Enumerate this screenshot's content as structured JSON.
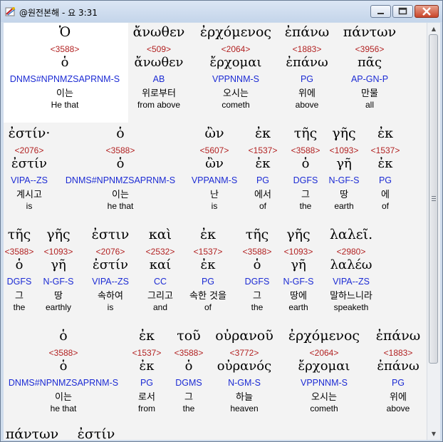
{
  "window": {
    "title": "@원전본해 - 요 3:31"
  },
  "rows": [
    [
      {
        "greek": "Ὁ",
        "strong": "<3588>",
        "lemma": "ὁ",
        "morph": "DNMS#NPNMZSAPRNM-S",
        "korean": "이는",
        "english": "He that"
      },
      {
        "greek": "ἄνωθεν",
        "strong": "<509>",
        "lemma": "ἄνωθεν",
        "morph": "AB",
        "korean": "위로부터",
        "english": "from above"
      },
      {
        "greek": "ἐρχόμενος",
        "strong": "<2064>",
        "lemma": "ἔρχομαι",
        "morph": "VPPNNM-S",
        "korean": "오시는",
        "english": "cometh"
      },
      {
        "greek": "ἐπάνω",
        "strong": "<1883>",
        "lemma": "ἐπάνω",
        "morph": "PG",
        "korean": "위에",
        "english": "above"
      },
      {
        "greek": "πάντων",
        "strong": "<3956>",
        "lemma": "πᾶς",
        "morph": "AP-GN-P",
        "korean": "만물",
        "english": "all"
      }
    ],
    [
      {
        "greek": "ἐστίν·",
        "strong": "<2076>",
        "lemma": "ἐστίν",
        "morph": "VIPA--ZS",
        "korean": "계시고",
        "english": "is"
      },
      {
        "greek": "ὁ",
        "strong": "<3588>",
        "lemma": "ὁ",
        "morph": "DNMS#NPNMZSAPRNM-S",
        "korean": "이는",
        "english": "he that"
      },
      {
        "greek": "ὢν",
        "strong": "<5607>",
        "lemma": "ὢν",
        "morph": "VPPANM-S",
        "korean": "난",
        "english": "is"
      },
      {
        "greek": "ἐκ",
        "strong": "<1537>",
        "lemma": "ἐκ",
        "morph": "PG",
        "korean": "에서",
        "english": "of"
      },
      {
        "greek": "τῆς",
        "strong": "<3588>",
        "lemma": "ὁ",
        "morph": "DGFS",
        "korean": "그",
        "english": "the"
      },
      {
        "greek": "γῆς",
        "strong": "<1093>",
        "lemma": "γῆ",
        "morph": "N-GF-S",
        "korean": "땅",
        "english": "earth"
      },
      {
        "greek": "ἐκ",
        "strong": "<1537>",
        "lemma": "ἐκ",
        "morph": "PG",
        "korean": "에",
        "english": "of"
      }
    ],
    [
      {
        "greek": "τῆς",
        "strong": "<3588>",
        "lemma": "ὁ",
        "morph": "DGFS",
        "korean": "그",
        "english": "the"
      },
      {
        "greek": "γῆς",
        "strong": "<1093>",
        "lemma": "γῆ",
        "morph": "N-GF-S",
        "korean": "땅",
        "english": "earthly"
      },
      {
        "greek": "ἐστιν",
        "strong": "<2076>",
        "lemma": "ἐστίν",
        "morph": "VIPA--ZS",
        "korean": "속하여",
        "english": "is"
      },
      {
        "greek": "καὶ",
        "strong": "<2532>",
        "lemma": "καί",
        "morph": "CC",
        "korean": "그리고",
        "english": "and"
      },
      {
        "greek": "ἐκ",
        "strong": "<1537>",
        "lemma": "ἐκ",
        "morph": "PG",
        "korean": "속한 것을",
        "english": "of"
      },
      {
        "greek": "τῆς",
        "strong": "<3588>",
        "lemma": "ὁ",
        "morph": "DGFS",
        "korean": "그",
        "english": "the"
      },
      {
        "greek": "γῆς",
        "strong": "<1093>",
        "lemma": "γῆ",
        "morph": "N-GF-S",
        "korean": "땅에",
        "english": "earth"
      },
      {
        "greek": "λαλεῖ.",
        "strong": "<2980>",
        "lemma": "λαλέω",
        "morph": "VIPA--ZS",
        "korean": "말하느니라",
        "english": "speaketh"
      }
    ],
    [
      {
        "greek": "ὁ",
        "strong": "<3588>",
        "lemma": "ὁ",
        "morph": "DNMS#NPNMZSAPRNM-S",
        "korean": "이는",
        "english": "he that"
      },
      {
        "greek": "ἐκ",
        "strong": "<1537>",
        "lemma": "ἐκ",
        "morph": "PG",
        "korean": "로서",
        "english": "from"
      },
      {
        "greek": "τοῦ",
        "strong": "<3588>",
        "lemma": "ὁ",
        "morph": "DGMS",
        "korean": "그",
        "english": "the"
      },
      {
        "greek": "οὐρανοῦ",
        "strong": "<3772>",
        "lemma": "οὐρανός",
        "morph": "N-GM-S",
        "korean": "하늘",
        "english": "heaven"
      },
      {
        "greek": "ἐρχόμενος",
        "strong": "<2064>",
        "lemma": "ἔρχομαι",
        "morph": "VPPNNM-S",
        "korean": "오시는",
        "english": "cometh"
      },
      {
        "greek": "ἐπάνω",
        "strong": "<1883>",
        "lemma": "ἐπάνω",
        "morph": "PG",
        "korean": "위에",
        "english": "above"
      }
    ],
    [
      {
        "greek": "πάντων",
        "strong": "",
        "lemma": "",
        "morph": "",
        "korean": "",
        "english": ""
      },
      {
        "greek": "ἐστίν",
        "strong": "",
        "lemma": "",
        "morph": "",
        "korean": "",
        "english": ""
      }
    ]
  ],
  "colors": {
    "greek": "#000000",
    "strong": "#b22222",
    "morph": "#1c2bd4",
    "selection_bg": "#ffffff",
    "content_bg": "#f3f3f3"
  },
  "icons": {
    "app": "bible-app-icon",
    "minimize": "minimize-icon",
    "maximize": "maximize-icon",
    "close": "close-icon",
    "scroll_up": "scroll-up-icon",
    "scroll_down": "scroll-down-icon"
  }
}
